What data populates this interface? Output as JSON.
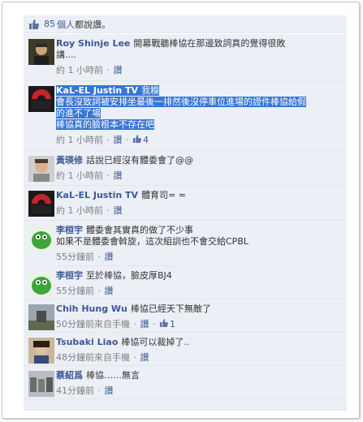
{
  "likes": {
    "count": "85",
    "unit": "個人",
    "text": "都說讚。"
  },
  "comments": [
    {
      "name": "Roy Shinje Lee",
      "text_lines": [
        "開幕戰聽棒協在那邊致詞真的覺得很敗",
        "講...."
      ],
      "time": "約 1 小時前",
      "reply": "讚",
      "likes": ""
    },
    {
      "name": "KaL-EL Justin TV",
      "text_lines": [
        "我糗",
        "會長沒致詞被安排坐最後一排然後沒停車位進場的證件棒協給假",
        "的進不了場",
        "棒協真的臉根本不存在吧"
      ],
      "time": "約 1 小時前",
      "reply": "讚",
      "likes": "4"
    },
    {
      "name": "黃瑛修",
      "text_lines": [
        "話說已經沒有體委會了@@"
      ],
      "time": "約 1 小時前",
      "reply": "讚",
      "likes": ""
    },
    {
      "name": "KaL-EL Justin TV",
      "text_lines": [
        "體育司= ="
      ],
      "time": "約 1 小時前",
      "reply": "讚",
      "likes": ""
    },
    {
      "name": "李桓宇",
      "text_lines": [
        "體委會其實真的做了不少事",
        "如果不是體委會斡旋，這次組訓也不會交給CPBL"
      ],
      "time": "55分鐘前",
      "reply": "讚",
      "likes": ""
    },
    {
      "name": "李桓宇",
      "text_lines": [
        "至於棒協，臉皮厚BJ4"
      ],
      "time": "55分鐘前",
      "reply": "讚",
      "likes": ""
    },
    {
      "name": "Chih Hung Wu",
      "text_lines": [
        "棒協已經天下無敵了"
      ],
      "time": "50分鐘前來自手機",
      "reply": "讚",
      "likes": "1"
    },
    {
      "name": "Tsubaki Liao",
      "text_lines": [
        "棒協可以裁掉了.."
      ],
      "time": "48分鐘前來自手機",
      "reply": "讚",
      "likes": ""
    },
    {
      "name": "蔡紹爲",
      "text_lines": [
        "棒協……無言"
      ],
      "time": "41分鐘前",
      "reply": "讚",
      "likes": ""
    }
  ],
  "colors": {
    "link": "#3b5998",
    "panel": "#eceff5",
    "highlight": "#3875d7"
  }
}
